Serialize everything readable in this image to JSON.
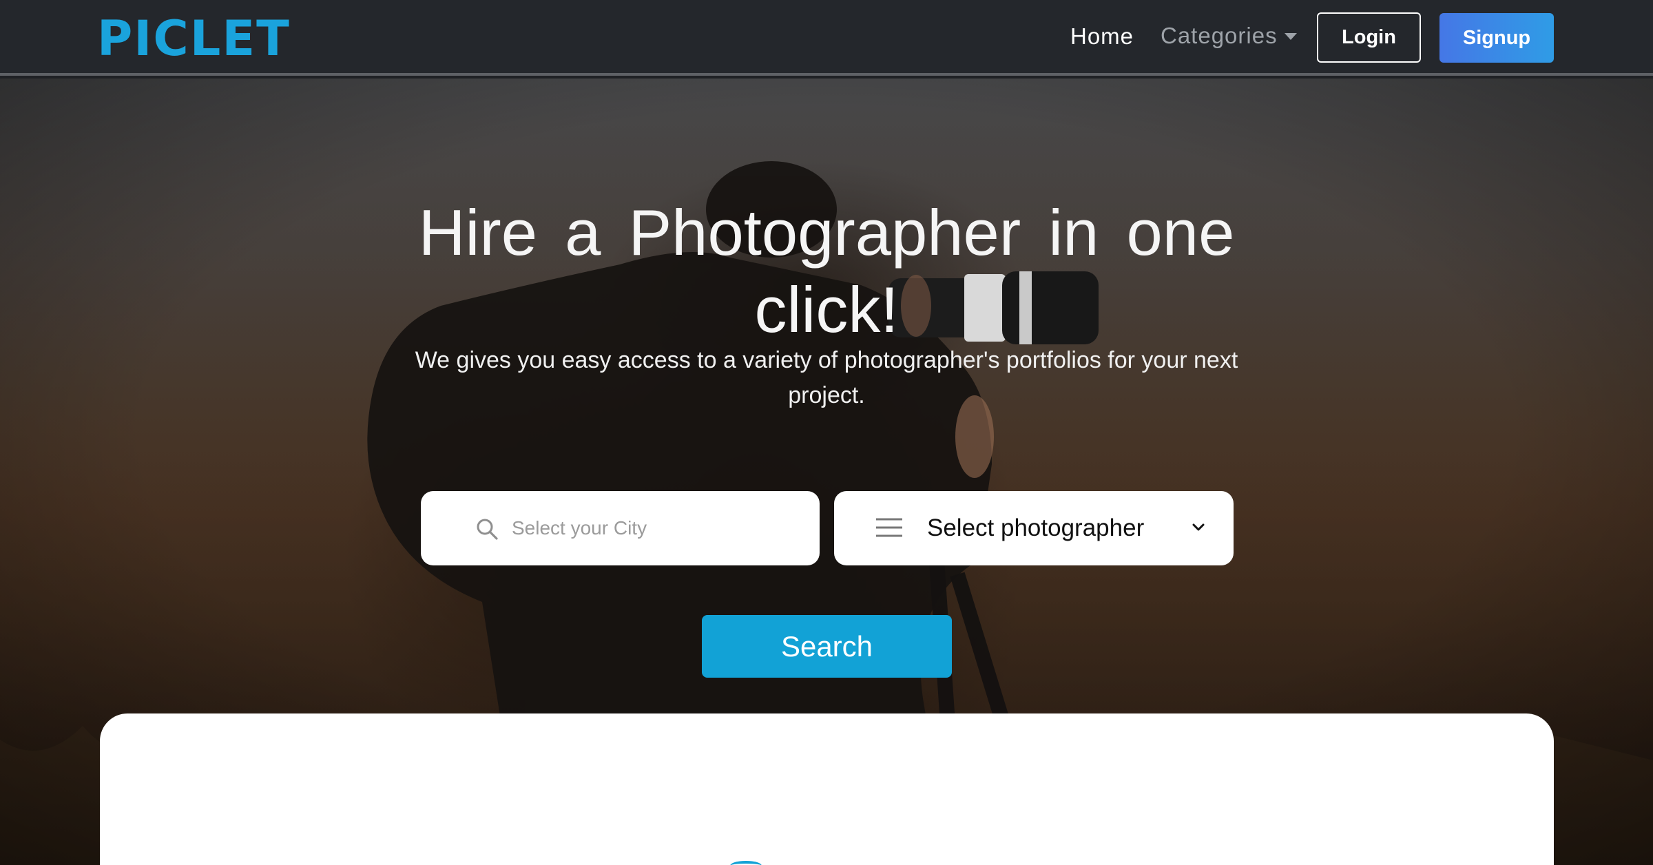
{
  "navbar": {
    "logo": "PICLET",
    "links": {
      "home": "Home",
      "categories": "Categories"
    },
    "login_label": "Login",
    "signup_label": "Signup"
  },
  "hero": {
    "title": "Hire a Photographer in one click!",
    "subtitle": "We gives you easy access to a variety of photographer's portfolios for your next project.",
    "city_search": {
      "placeholder": "Select your City",
      "value": ""
    },
    "photographer_select": {
      "selected": "Select photographer"
    },
    "search_label": "Search"
  },
  "colors": {
    "brand": "#1aa3dc",
    "search_button": "#12a2d6",
    "signup_gradient_start": "#4577e6",
    "signup_gradient_end": "#2f9ce6",
    "navbar_bg": "#24272c"
  },
  "icons": {
    "city_search": "search-icon",
    "photographer_select": "menu-icon",
    "dropdown": "chevron-down-icon",
    "categories_caret": "caret-down-icon"
  }
}
